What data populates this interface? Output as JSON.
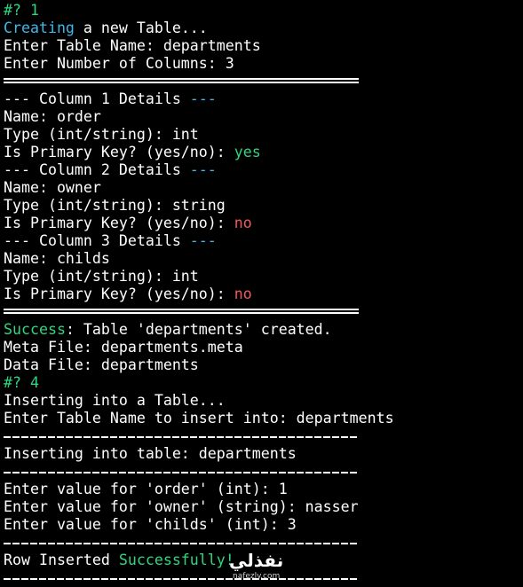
{
  "colors": {
    "background": "#000000",
    "text": "#ffffff",
    "success_green": "#2fd67f",
    "info_cyan": "#3fb8e8",
    "no_red": "#f05a5a"
  },
  "session": {
    "prompt1": "#? 1",
    "creating_word": "Creating",
    "creating_rest": " a new Table...",
    "enter_table_name": "Enter Table Name: departments",
    "enter_num_columns": "Enter Number of Columns: 3",
    "columns": [
      {
        "header_prefix": "--- Column 1 Details ",
        "header_suffix": "---",
        "name_line": "Name: order",
        "type_line": "Type (int/string): int",
        "pk_prompt": "Is Primary Key? (yes/no): ",
        "pk_answer": "yes"
      },
      {
        "header_prefix": "--- Column 2 Details ",
        "header_suffix": "---",
        "name_line": "Name: owner",
        "type_line": "Type (int/string): string",
        "pk_prompt": "Is Primary Key? (yes/no): ",
        "pk_answer": "no"
      },
      {
        "header_prefix": "--- Column 3 Details ",
        "header_suffix": "---",
        "name_line": "Name: childs",
        "type_line": "Type (int/string): int",
        "pk_prompt": "Is Primary Key? (yes/no): ",
        "pk_answer": "no"
      }
    ],
    "success_word": "Success",
    "success_rest": ": Table 'departments' created.",
    "meta_file": "Meta File: departments.meta",
    "data_file": "Data File: departments",
    "prompt2": "#? 4",
    "inserting_title": "Inserting into a Table...",
    "enter_insert_table": "Enter Table Name to insert into: departments",
    "inserting_into": "Inserting into table: departments",
    "value_order": "Enter value for 'order' (int): 1",
    "value_owner": "Enter value for 'owner' (string): nasser",
    "value_childs": "Enter value for 'childs' (int): 3",
    "row_inserted_prefix": "Row Inserted ",
    "row_inserted_word": "Successfully!"
  },
  "watermark": {
    "name": "نفذلي",
    "url": "nafezly.com"
  }
}
